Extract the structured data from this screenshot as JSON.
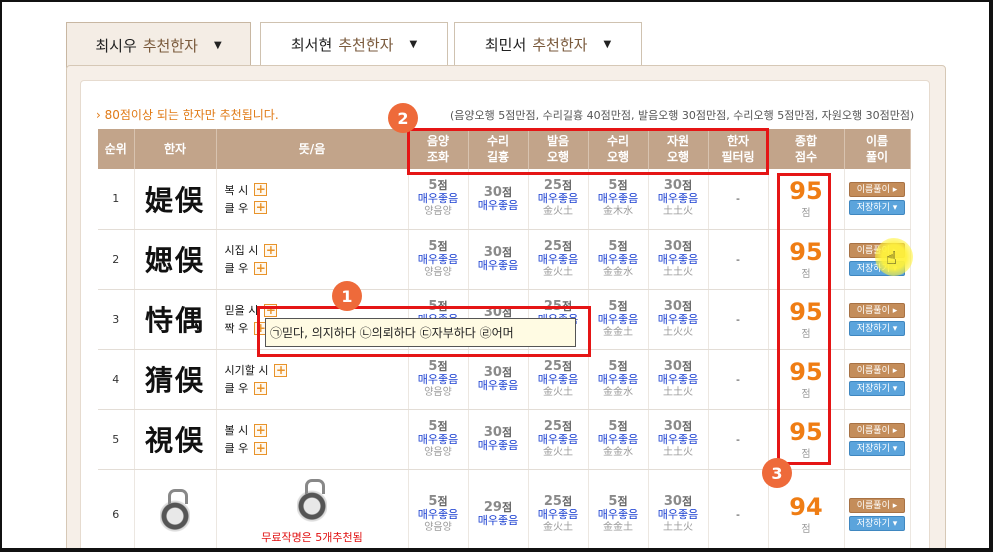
{
  "tabs": [
    {
      "name": "최시우",
      "suffix": "추천한자"
    },
    {
      "name": "최서현",
      "suffix": "추천한자"
    },
    {
      "name": "최민서",
      "suffix": "추천한자"
    }
  ],
  "notice": "› 80점이상 되는 한자만 추천됩니다.",
  "criteria": "(음양오행 5점만점, 수리길흉 40점만점, 발음오행 30점만점, 수리오행 5점만점, 자원오행 30점만점)",
  "headers": {
    "rank": "순위",
    "hanja": "한자",
    "meaning": "뜻/음",
    "yinyang": [
      "음양",
      "조화"
    ],
    "suri": [
      "수리",
      "길흉"
    ],
    "balum": [
      "발음",
      "오행"
    ],
    "suri_ohaeng": [
      "수리",
      "오행"
    ],
    "jawon": [
      "자원",
      "오행"
    ],
    "filter": [
      "한자",
      "필터링"
    ],
    "total": [
      "종합",
      "점수"
    ],
    "name_reading": [
      "이름",
      "풀이"
    ]
  },
  "buttons": {
    "reading": "이름풀이 ▸",
    "save": "저장하기 ▾"
  },
  "labels": {
    "good": "매우좋음",
    "unit": "점",
    "dash": "-"
  },
  "rows": [
    {
      "rank": "1",
      "hanja": "媞俁",
      "m1": "복 시",
      "m2": "클 우",
      "yy": "5",
      "yy_sub": "양음양",
      "su": "30",
      "ba": "25",
      "ba_sub": "金火土",
      "so": "5",
      "so_sub": "金木水",
      "ja": "30",
      "ja_sub": "土土火",
      "total": "95"
    },
    {
      "rank": "2",
      "hanja": "媤俁",
      "m1": "시집 시",
      "m2": "클 우",
      "yy": "5",
      "yy_sub": "양음양",
      "su": "30",
      "ba": "25",
      "ba_sub": "金火土",
      "so": "5",
      "so_sub": "金金水",
      "ja": "30",
      "ja_sub": "土土火",
      "total": "95"
    },
    {
      "rank": "3",
      "hanja": "恃偶",
      "m1": "믿을 시",
      "m2": "짝 우",
      "yy": "5",
      "yy_sub": "양음양",
      "su": "30",
      "ba": "25",
      "ba_sub": "金火土",
      "so": "5",
      "so_sub": "金金土",
      "ja": "30",
      "ja_sub": "土火火",
      "total": "95"
    },
    {
      "rank": "4",
      "hanja": "猜俁",
      "m1": "시기할 시",
      "m2": "클 우",
      "yy": "5",
      "yy_sub": "양음양",
      "su": "30",
      "ba": "25",
      "ba_sub": "金火土",
      "so": "5",
      "so_sub": "金金水",
      "ja": "30",
      "ja_sub": "土土火",
      "total": "95"
    },
    {
      "rank": "5",
      "hanja": "視俁",
      "m1": "볼 시",
      "m2": "클 우",
      "yy": "5",
      "yy_sub": "양음양",
      "su": "30",
      "ba": "25",
      "ba_sub": "金火土",
      "so": "5",
      "so_sub": "金金水",
      "ja": "30",
      "ja_sub": "土土火",
      "total": "95"
    },
    {
      "rank": "6",
      "free_note": "무료작명은 5개추천됨",
      "yy": "5",
      "yy_sub": "양음양",
      "su": "29",
      "ba": "25",
      "ba_sub": "金火土",
      "so": "5",
      "so_sub": "金金土",
      "ja": "30",
      "ja_sub": "土土火",
      "total": "94"
    }
  ],
  "tooltip": "㉠믿다, 의지하다 ㉡의뢰하다 ㉢자부하다 ㉣어머",
  "annotations": [
    "1",
    "2",
    "3"
  ]
}
